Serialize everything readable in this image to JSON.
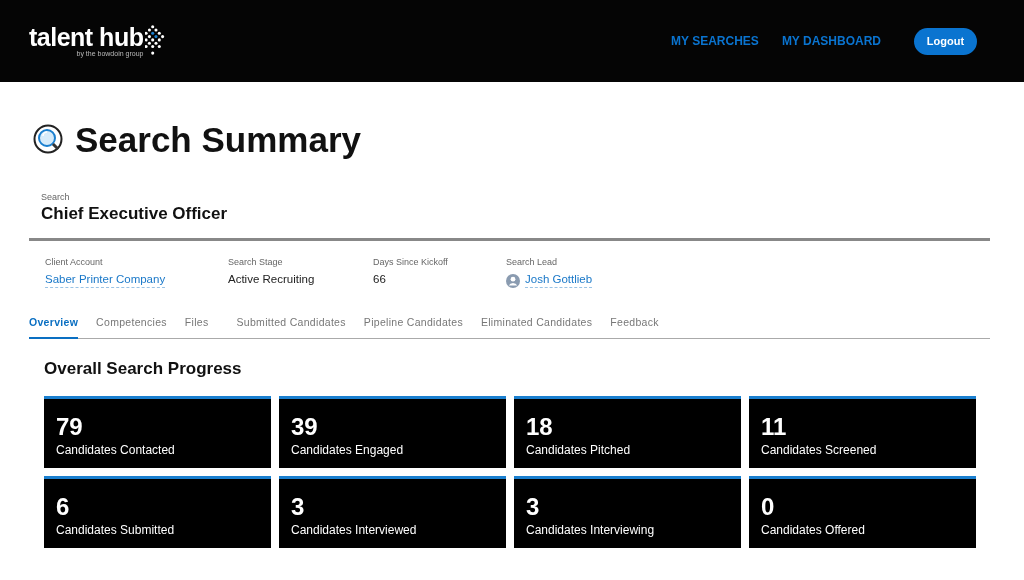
{
  "header": {
    "logo": {
      "name": "talent hub",
      "tagline": "by the bowdoin group"
    },
    "nav": [
      "MY SEARCHES",
      "MY DASHBOARD"
    ],
    "logout": "Logout"
  },
  "page_title": "Search Summary",
  "search": {
    "label": "Search",
    "value": "Chief Executive Officer"
  },
  "details": [
    {
      "label": "Client Account",
      "value": "Saber Printer Company",
      "kind": "link"
    },
    {
      "label": "Search Stage",
      "value": "Active Recruiting",
      "kind": "text"
    },
    {
      "label": "Days Since Kickoff",
      "value": "66",
      "kind": "text"
    },
    {
      "label": "Search Lead",
      "value": "Josh Gottlieb",
      "kind": "person"
    }
  ],
  "tabs": [
    {
      "label": "Overview",
      "selected": true
    },
    {
      "label": "Competencies",
      "selected": false
    },
    {
      "label": "Files",
      "selected": false
    },
    {
      "label": "Submitted Candidates",
      "selected": false
    },
    {
      "label": "Pipeline Candidates",
      "selected": false
    },
    {
      "label": "Eliminated Candidates",
      "selected": false
    },
    {
      "label": "Feedback",
      "selected": false
    }
  ],
  "progress": {
    "title": "Overall Search Progress",
    "stats": [
      {
        "value": "79",
        "label": "Candidates Contacted"
      },
      {
        "value": "39",
        "label": "Candidates Engaged"
      },
      {
        "value": "18",
        "label": "Candidates Pitched"
      },
      {
        "value": "11",
        "label": "Candidates Screened"
      },
      {
        "value": "6",
        "label": "Candidates Submitted"
      },
      {
        "value": "3",
        "label": "Candidates Interviewed"
      },
      {
        "value": "3",
        "label": "Candidates Interviewing"
      },
      {
        "value": "0",
        "label": "Candidates Offered"
      }
    ]
  }
}
